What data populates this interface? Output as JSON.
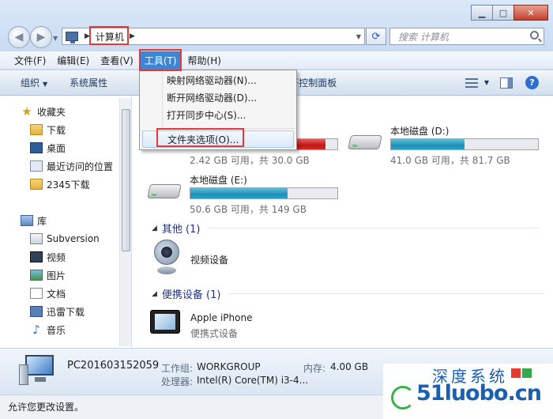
{
  "window": {
    "minimize_glyph": "▁",
    "maximize_glyph": "□",
    "close_glyph": "✕"
  },
  "address": {
    "crumb": "计算机",
    "search_placeholder": "搜索 计算机"
  },
  "menubar": [
    {
      "label": "文件(F)"
    },
    {
      "label": "编辑(E)"
    },
    {
      "label": "查看(V)"
    },
    {
      "label": "工具(T)"
    },
    {
      "label": "帮助(H)"
    }
  ],
  "toolbar": {
    "organize": "组织",
    "system_properties": "系统属性",
    "control_panel": "打开控制面板"
  },
  "tools_menu": [
    {
      "label": "映射网络驱动器(N)..."
    },
    {
      "label": "断开网络驱动器(D)..."
    },
    {
      "label": "打开同步中心(S)..."
    },
    {
      "label": "文件夹选项(O)..."
    }
  ],
  "nav": {
    "favorites": "收藏夹",
    "downloads": "下载",
    "desktop": "桌面",
    "recent": "最近访问的位置",
    "folder_2345": "2345下载",
    "libraries": "库",
    "subversion": "Subversion",
    "videos": "视频",
    "pictures": "图片",
    "documents": "文档",
    "xunlei": "迅雷下载",
    "music": "音乐"
  },
  "drives": [
    {
      "name": "",
      "size": "2.42 GB 可用，共 30.0 GB",
      "used_fraction": 0.92,
      "status": "red"
    },
    {
      "name": "本地磁盘 (D:)",
      "size": "41.0 GB 可用，共 81.7 GB",
      "used_fraction": 0.5,
      "status": "normal"
    },
    {
      "name": "本地磁盘 (E:)",
      "size": "50.6 GB 可用，共 149 GB",
      "used_fraction": 0.66,
      "status": "normal"
    }
  ],
  "groups": {
    "other": "其他 (1)",
    "portable": "便携设备 (1)"
  },
  "other_items": [
    {
      "name": "视频设备"
    }
  ],
  "portable_items": [
    {
      "name": "Apple iPhone",
      "type": "便携式设备"
    }
  ],
  "details": {
    "pc_name": "PC201603152059",
    "workgroup_label": "工作组:",
    "workgroup": "WORKGROUP",
    "memory_label": "内存:",
    "memory": "4.00 GB",
    "cpu_label": "处理器:",
    "cpu": "Intel(R) Core(TM) i3-4..."
  },
  "status": "允许您更改设置。",
  "watermark": {
    "top": "深度系统",
    "main": "51luobo.cn"
  }
}
